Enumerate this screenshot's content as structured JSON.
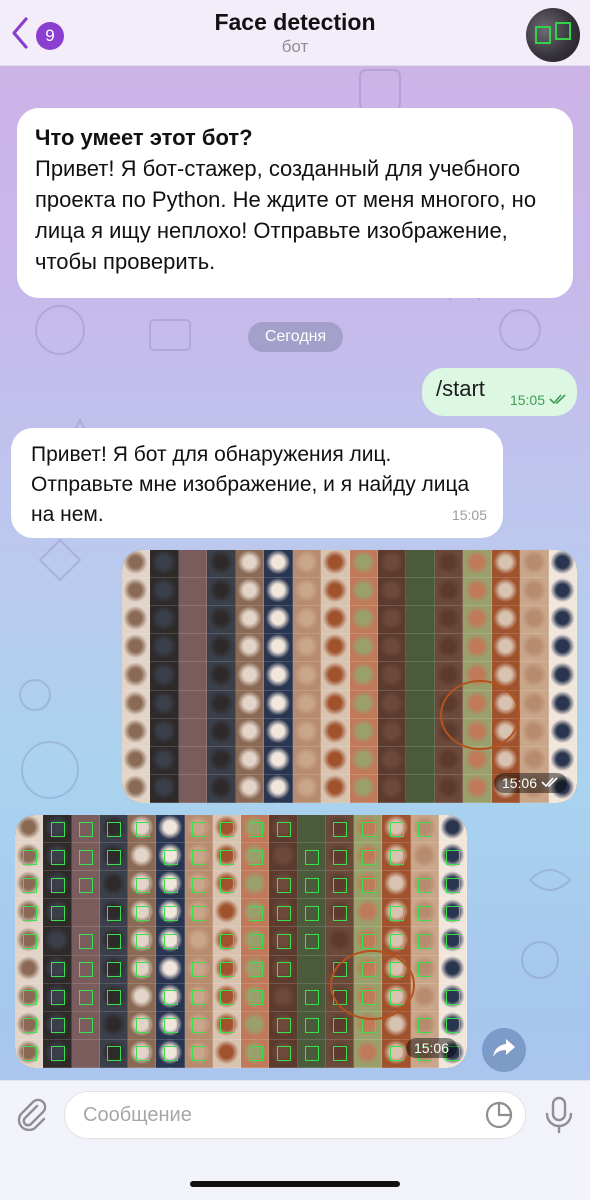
{
  "header": {
    "unread_count": "9",
    "title": "Face detection",
    "subtitle": "бот"
  },
  "intro": {
    "heading": "Что умеет этот бот?",
    "body": "Привет! Я бот-стажер, созданный для учебного проекта по Python. Не ждите от меня многого, но лица я ищу неплохо! Отправьте изображение, чтобы проверить."
  },
  "date_separator": "Сегодня",
  "messages": [
    {
      "direction": "out",
      "text": "/start",
      "time": "15:05",
      "status": "read"
    },
    {
      "direction": "in",
      "text": "Привет! Я бот для обнаружения лиц. Отправьте мне изображение, и я найду лица на нем.",
      "time": "15:05"
    },
    {
      "direction": "out",
      "type": "photo",
      "description": "collage of portrait photos",
      "time": "15:06",
      "status": "read"
    },
    {
      "direction": "in",
      "type": "photo",
      "description": "collage with detected faces outlined in green boxes",
      "time": "15:06"
    }
  ],
  "input": {
    "placeholder": "Сообщение"
  },
  "icons": {
    "back": "chevron-left-icon",
    "attach": "paperclip-icon",
    "sticker": "sticker-icon",
    "mic": "microphone-icon",
    "share": "share-arrow-icon",
    "read": "double-check-icon"
  },
  "colors": {
    "accent": "#8b3fd1",
    "outgoing_bubble": "#dcf8e2",
    "face_box": "#3ce04c"
  }
}
